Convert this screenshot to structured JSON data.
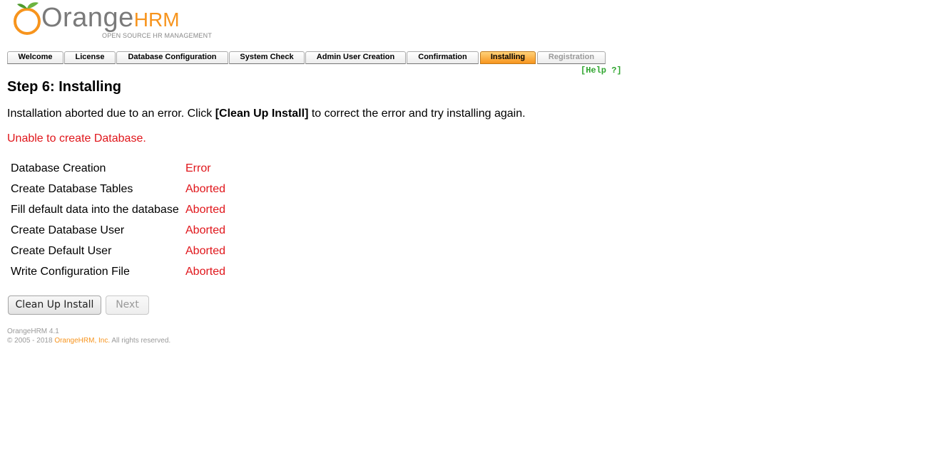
{
  "logo": {
    "word_main": "Orange",
    "word_accent": "HRM",
    "tagline": "OPEN SOURCE HR MANAGEMENT",
    "brand_color": "#f7941d"
  },
  "tabs": [
    {
      "label": "Welcome",
      "state": "normal"
    },
    {
      "label": "License",
      "state": "normal"
    },
    {
      "label": "Database Configuration",
      "state": "normal"
    },
    {
      "label": "System Check",
      "state": "normal"
    },
    {
      "label": "Admin User Creation",
      "state": "normal"
    },
    {
      "label": "Confirmation",
      "state": "normal"
    },
    {
      "label": "Installing",
      "state": "active"
    },
    {
      "label": "Registration",
      "state": "disabled"
    }
  ],
  "help_link": "[Help ?]",
  "step_title": "Step 6: Installing",
  "intro": {
    "before": "Installation aborted due to an error. Click ",
    "bold": "[Clean Up Install]",
    "after": " to correct the error and try installing again."
  },
  "error_message": "Unable to create Database.",
  "status_rows": [
    {
      "task": "Database Creation",
      "status": "Error"
    },
    {
      "task": "Create Database Tables",
      "status": "Aborted"
    },
    {
      "task": "Fill default data into the database",
      "status": "Aborted"
    },
    {
      "task": "Create Database User",
      "status": "Aborted"
    },
    {
      "task": "Create Default User",
      "status": "Aborted"
    },
    {
      "task": "Write Configuration File",
      "status": "Aborted"
    }
  ],
  "buttons": {
    "cleanup": "Clean Up Install",
    "next": "Next"
  },
  "footer": {
    "version": "OrangeHRM 4.1",
    "copyright_prefix": "© 2005 - 2018 ",
    "company": "OrangeHRM, Inc.",
    "rights": " All rights reserved."
  },
  "colors": {
    "error_red": "#e0161b",
    "help_green": "#2fa52f",
    "active_tab": "#f7941d"
  }
}
